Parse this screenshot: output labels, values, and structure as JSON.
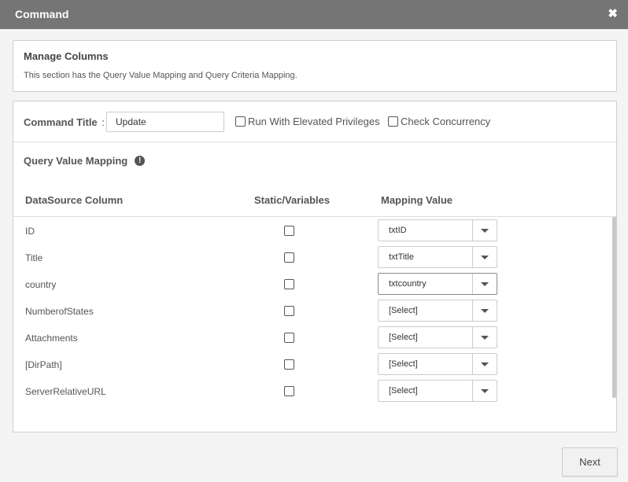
{
  "dialog": {
    "title": "Command",
    "close_icon": "close-icon"
  },
  "manage_columns": {
    "heading": "Manage Columns",
    "description": "This section has the Query Value Mapping and Query Criteria Mapping."
  },
  "command": {
    "title_label": "Command Title",
    "title_separator": ":",
    "title_value": "Update",
    "run_elevated_label": "Run With Elevated Privileges",
    "run_elevated_checked": false,
    "check_concurrency_label": "Check Concurrency",
    "check_concurrency_checked": false
  },
  "query_value_mapping": {
    "title": "Query Value Mapping",
    "info_icon": "info-icon",
    "headers": {
      "datasource_column": "DataSource Column",
      "static_variables": "Static/Variables",
      "mapping_value": "Mapping Value"
    },
    "rows": [
      {
        "column": "ID",
        "static": false,
        "mapping": "txtID"
      },
      {
        "column": "Title",
        "static": false,
        "mapping": "txtTitle"
      },
      {
        "column": "country",
        "static": false,
        "mapping": "txtcountry"
      },
      {
        "column": "NumberofStates",
        "static": false,
        "mapping": "[Select]"
      },
      {
        "column": "Attachments",
        "static": false,
        "mapping": "[Select]"
      },
      {
        "column": "[DirPath]",
        "static": false,
        "mapping": "[Select]"
      },
      {
        "column": "ServerRelativeURL",
        "static": false,
        "mapping": "[Select]"
      }
    ]
  },
  "footer": {
    "next_label": "Next"
  }
}
